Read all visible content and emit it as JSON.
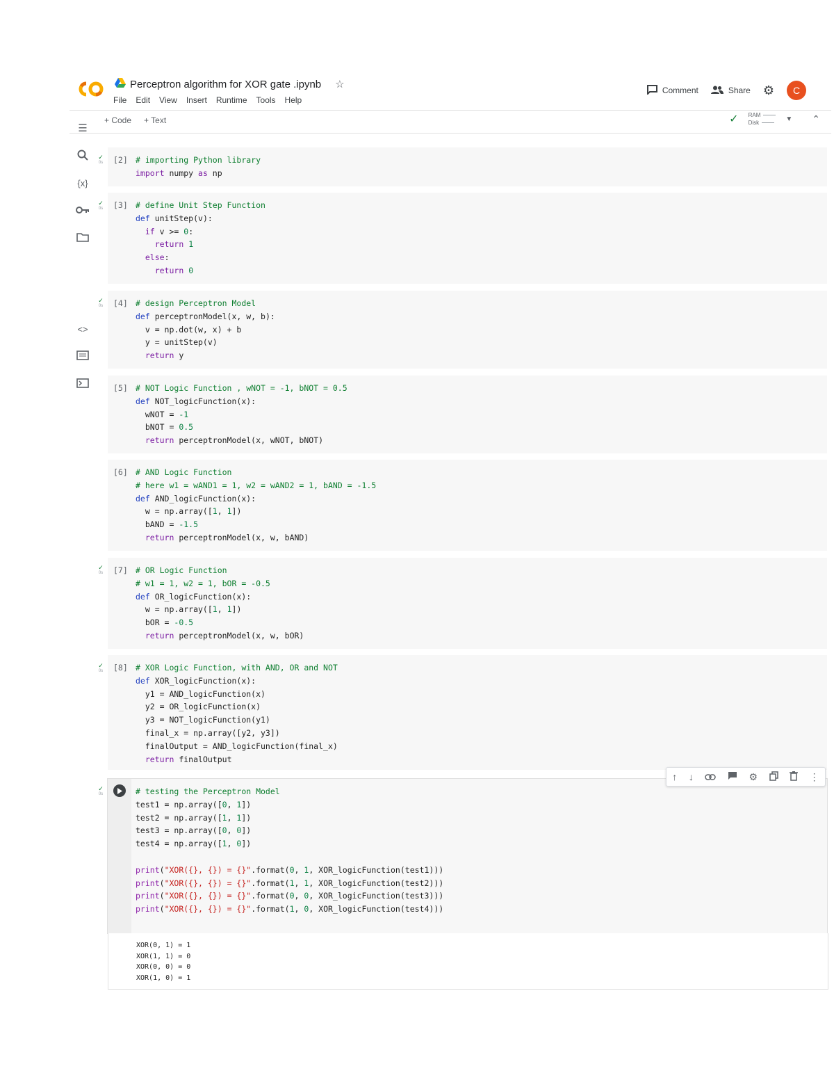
{
  "header": {
    "doc_title": "Perceptron algorithm for XOR gate .ipynb",
    "menu": [
      "File",
      "Edit",
      "View",
      "Insert",
      "Runtime",
      "Tools",
      "Help"
    ],
    "comment_label": "Comment",
    "share_label": "Share",
    "avatar_letter": "C"
  },
  "toolbar": {
    "add_code": "+ Code",
    "add_text": "+ Text",
    "ram_label": "RAM",
    "disk_label": "Disk"
  },
  "cells": [
    {
      "exec": "[2]",
      "code_html": "<span class=\"cm\"># importing Python library</span>\n<span class=\"kw\">import</span> numpy <span class=\"kw\">as</span> np"
    },
    {
      "exec": "[3]",
      "code_html": "<span class=\"cm\"># define Unit Step Function</span>\n<span class=\"kd\">def</span> unitStep(v):\n  <span class=\"kw\">if</span> v &gt;= <span class=\"nm\">0</span>:\n    <span class=\"kw\">return</span> <span class=\"nm\">1</span>\n  <span class=\"kw\">else</span>:\n    <span class=\"kw\">return</span> <span class=\"nm\">0</span>"
    },
    {
      "exec": "[4]",
      "code_html": "<span class=\"cm\"># design Perceptron Model</span>\n<span class=\"kd\">def</span> perceptronModel(x, w, b):\n  v = np.dot(w, x) + b\n  y = unitStep(v)\n  <span class=\"kw\">return</span> y"
    },
    {
      "exec": "[5]",
      "code_html": "<span class=\"cm\"># NOT Logic Function , wNOT = -1, bNOT = 0.5</span>\n<span class=\"kd\">def</span> NOT_logicFunction(x):\n  wNOT = <span class=\"nm\">-1</span>\n  bNOT = <span class=\"nm\">0.5</span>\n  <span class=\"kw\">return</span> perceptronModel(x, wNOT, bNOT)"
    },
    {
      "exec": "[6]",
      "code_html": "<span class=\"cm\"># AND Logic Function</span>\n<span class=\"cm\"># here w1 = wAND1 = 1, w2 = wAND2 = 1, bAND = -1.5</span>\n<span class=\"kd\">def</span> AND_logicFunction(x):\n  w = np.array([<span class=\"nm\">1</span>, <span class=\"nm\">1</span>])\n  bAND = <span class=\"nm\">-1.5</span>\n  <span class=\"kw\">return</span> perceptronModel(x, w, bAND)"
    },
    {
      "exec": "[7]",
      "code_html": "<span class=\"cm\"># OR Logic Function</span>\n<span class=\"cm\"># w1 = 1, w2 = 1, bOR = -0.5</span>\n<span class=\"kd\">def</span> OR_logicFunction(x):\n  w = np.array([<span class=\"nm\">1</span>, <span class=\"nm\">1</span>])\n  bOR = <span class=\"nm\">-0.5</span>\n  <span class=\"kw\">return</span> perceptronModel(x, w, bOR)"
    },
    {
      "exec": "[8]",
      "code_html": "<span class=\"cm\"># XOR Logic Function, with AND, OR and NOT</span>\n<span class=\"kd\">def</span> XOR_logicFunction(x):\n  y1 = AND_logicFunction(x)\n  y2 = OR_logicFunction(x)\n  y3 = NOT_logicFunction(y1)\n  final_x = np.array([y2, y3])\n  finalOutput = AND_logicFunction(final_x)\n  <span class=\"kw\">return</span> finalOutput"
    },
    {
      "exec": "",
      "code_html": "<span class=\"cm\"># testing the Perceptron Model</span>\ntest1 = np.array([<span class=\"nm\">0</span>, <span class=\"nm\">1</span>])\ntest2 = np.array([<span class=\"nm\">1</span>, <span class=\"nm\">1</span>])\ntest3 = np.array([<span class=\"nm\">0</span>, <span class=\"nm\">0</span>])\ntest4 = np.array([<span class=\"nm\">1</span>, <span class=\"nm\">0</span>])\n\n<span class=\"bi\">print</span>(<span class=\"st\">\"XOR({}, {}) = {}\"</span>.format(<span class=\"nm\">0</span>, <span class=\"nm\">1</span>, XOR_logicFunction(test1)))\n<span class=\"bi\">print</span>(<span class=\"st\">\"XOR({}, {}) = {}\"</span>.format(<span class=\"nm\">1</span>, <span class=\"nm\">1</span>, XOR_logicFunction(test2)))\n<span class=\"bi\">print</span>(<span class=\"st\">\"XOR({}, {}) = {}\"</span>.format(<span class=\"nm\">0</span>, <span class=\"nm\">0</span>, XOR_logicFunction(test3)))\n<span class=\"bi\">print</span>(<span class=\"st\">\"XOR({}, {}) = {}\"</span>.format(<span class=\"nm\">1</span>, <span class=\"nm\">0</span>, XOR_logicFunction(test4)))"
    }
  ],
  "output_text": "XOR(0, 1) = 1\nXOR(1, 1) = 0\nXOR(0, 0) = 0\nXOR(1, 0) = 1"
}
